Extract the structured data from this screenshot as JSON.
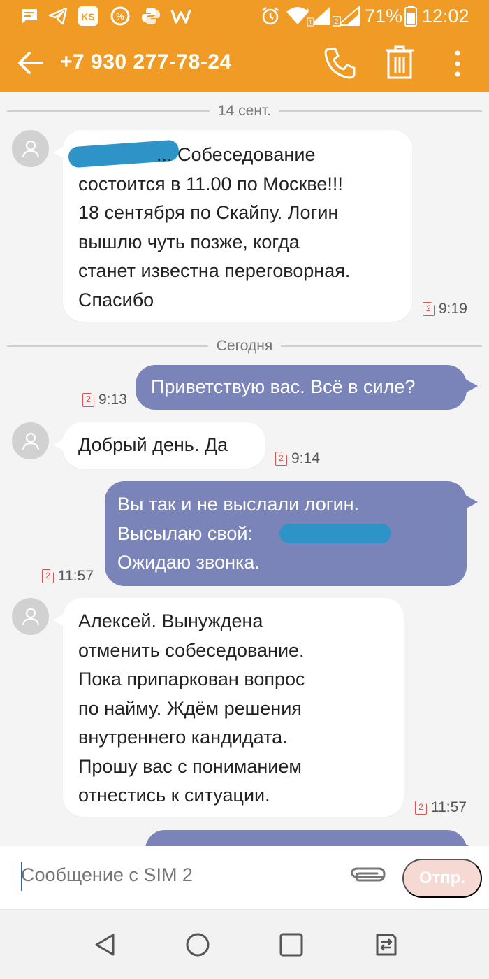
{
  "status_bar": {
    "battery_percent": "71%",
    "time": "12:02",
    "icons": [
      "message-icon",
      "telegram-icon",
      "ks-app-icon",
      "discount-icon",
      "python-icon",
      "w-app-icon",
      "alarm-icon",
      "wifi-icon",
      "signal-sim1-icon",
      "signal-sim2-icon",
      "battery-icon"
    ]
  },
  "header": {
    "phone_number": "+7 930 277-78-24",
    "accent_color": "#ef9b25"
  },
  "chat": {
    "dividers": [
      "14 сент.",
      "Сегодня"
    ],
    "messages": [
      {
        "direction": "in",
        "lines": [
          "... Собеседование",
          "состоится в 11.00 по Москве!!!",
          "18 сентября по Скайпу. Логин",
          "вышлю чуть позже, когда",
          "станет известна переговорная.",
          "Спасибо"
        ],
        "sim": "2",
        "time": "9:19"
      },
      {
        "direction": "out",
        "lines": [
          "Приветствую вас. Всё в силе?"
        ],
        "sim": "2",
        "time": "9:13"
      },
      {
        "direction": "in",
        "lines": [
          "Добрый день. Да"
        ],
        "sim": "2",
        "time": "9:14"
      },
      {
        "direction": "out",
        "lines": [
          "Вы так и не выслали логин.",
          "Высылаю свой:",
          "Ожидаю звонка."
        ],
        "sim": "2",
        "time": "11:57"
      },
      {
        "direction": "in",
        "lines": [
          "Алексей. Вынуждена",
          "отменить собеседование.",
          "Пока припаркован вопрос",
          "по найму. Ждём решения",
          "внутреннего кандидата.",
          "Прошу вас с пониманием",
          "отнестись к ситуации."
        ],
        "sim": "2",
        "time": "11:57"
      }
    ],
    "outgoing_color": "#7a84b9"
  },
  "composer": {
    "placeholder": "Сообщение с SIM 2",
    "send_label": "Отпр."
  },
  "navigation": {
    "buttons": [
      "back-nav-icon",
      "home-nav-icon",
      "recents-nav-icon",
      "switch-sim-icon"
    ]
  }
}
